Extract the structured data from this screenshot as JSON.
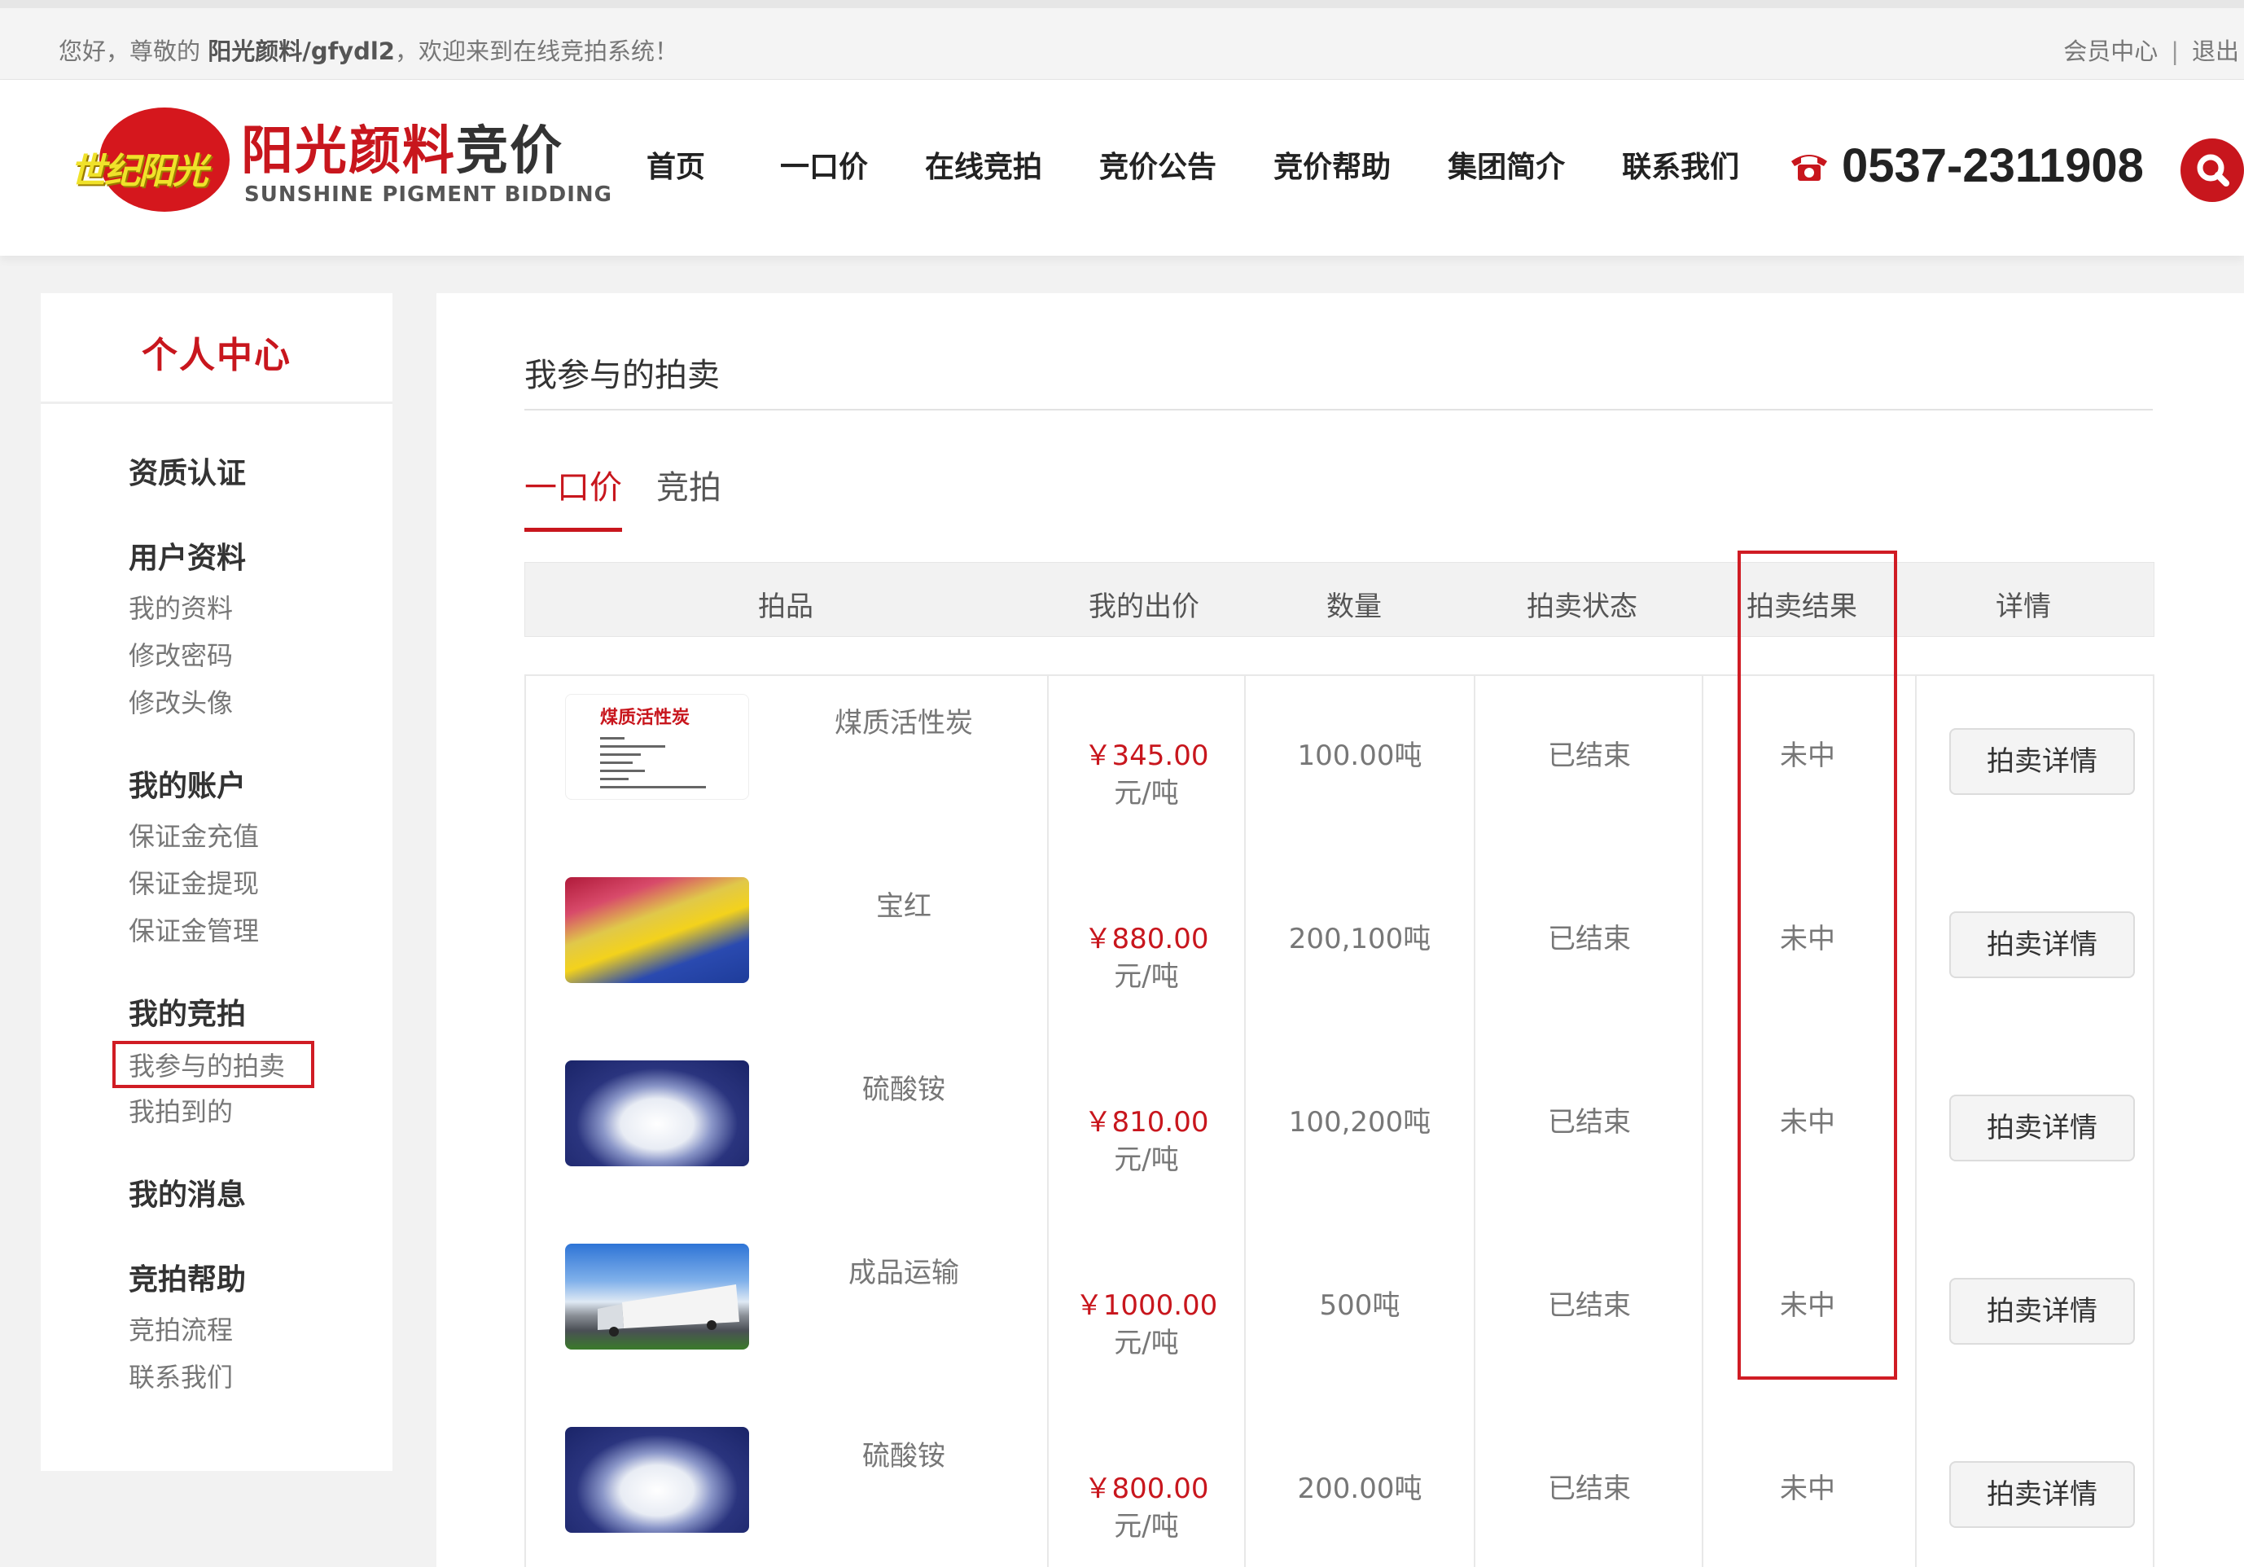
{
  "topbar": {
    "welcome_prefix": "您好，尊敬的",
    "username": "阳光颜料/gfydl2",
    "welcome_suffix": "，欢迎来到在线竞拍系统！",
    "member_center": "会员中心",
    "separator": "|",
    "logout": "退出"
  },
  "logo": {
    "script_text": "世纪阳光",
    "cn_name": "阳光颜料",
    "cn_suffix": "竞价",
    "en_name": "SUNSHINE PIGMENT BIDDING"
  },
  "nav": {
    "items": [
      "首页",
      "一口价",
      "在线竞拍",
      "竞价公告",
      "竞价帮助",
      "集团简介",
      "联系我们"
    ]
  },
  "phone": {
    "number": "0537-2311908",
    "icon": "phone-icon"
  },
  "search": {
    "icon": "search-icon"
  },
  "sidebar": {
    "title": "个人中心",
    "qualification": "资质认证",
    "user_profile": {
      "heading": "用户资料",
      "items": [
        "我的资料",
        "修改密码",
        "修改头像"
      ]
    },
    "my_account": {
      "heading": "我的账户",
      "items": [
        "保证金充值",
        "保证金提现",
        "保证金管理"
      ]
    },
    "my_bidding": {
      "heading": "我的竞拍",
      "items": [
        "我参与的拍卖",
        "我拍到的"
      ]
    },
    "my_messages": "我的消息",
    "bidding_help": {
      "heading": "竞拍帮助",
      "items": [
        "竞拍流程",
        "联系我们"
      ]
    }
  },
  "main": {
    "title": "我参与的拍卖",
    "tabs": [
      "一口价",
      "竞拍"
    ],
    "active_tab": "一口价",
    "columns": [
      "拍品",
      "我的出价",
      "数量",
      "拍卖状态",
      "拍卖结果",
      "详情"
    ],
    "rows": [
      {
        "image": "activated-carbon-label",
        "name": "煤质活性炭",
        "price": "￥345.00",
        "unit": "元/吨",
        "quantity": "100.00吨",
        "status": "已结束",
        "result": "未中",
        "detail": "拍卖详情",
        "label_title": "煤质活性炭"
      },
      {
        "image": "pigment-powders",
        "name": "宝红",
        "price": "￥880.00",
        "unit": "元/吨",
        "quantity": "200,100吨",
        "status": "已结束",
        "result": "未中",
        "detail": "拍卖详情"
      },
      {
        "image": "white-powder",
        "name": "硫酸铵",
        "price": "￥810.00",
        "unit": "元/吨",
        "quantity": "100,200吨",
        "status": "已结束",
        "result": "未中",
        "detail": "拍卖详情"
      },
      {
        "image": "truck-road",
        "name": "成品运输",
        "price": "￥1000.00",
        "unit": "元/吨",
        "quantity": "500吨",
        "status": "已结束",
        "result": "未中",
        "detail": "拍卖详情"
      },
      {
        "image": "white-powder",
        "name": "硫酸铵",
        "price": "￥800.00",
        "unit": "元/吨",
        "quantity": "200.00吨",
        "status": "已结束",
        "result": "未中",
        "detail": "拍卖详情"
      }
    ]
  },
  "colors": {
    "brand_red": "#c8161d",
    "annotation_red": "#d01c24",
    "logo_yellow": "#f0e22a"
  }
}
